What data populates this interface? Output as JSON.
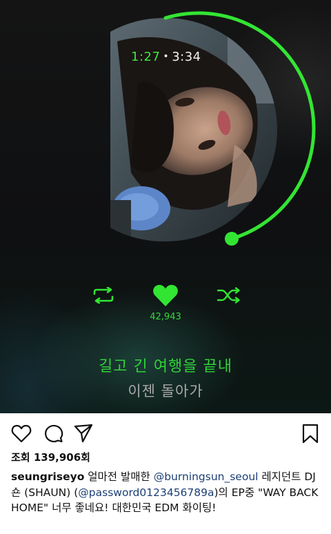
{
  "player": {
    "time_current": "1:27",
    "time_separator": "•",
    "time_total": "3:34",
    "progress_fraction": 0.406,
    "accent_color": "#33e533",
    "likes_count": "42,943"
  },
  "lyrics": {
    "current": "길고 긴 여행을 끝내",
    "next": "이젠 돌아가"
  },
  "post": {
    "views_label": "조회",
    "views_count": "139,906회",
    "username": "seungriseyo",
    "caption_part1": " 얼마전 발매한 ",
    "mention1": "@burningsun_seoul",
    "caption_part2": " 레지던트 DJ 숀 (SHAUN) (",
    "mention2": "@password0123456789a",
    "caption_part3": ")의 EP중 \"WAY BACK HOME\" 너무 좋네요! 대한민국 EDM 화이팅!"
  },
  "icons": {
    "repeat": "repeat-icon",
    "heart": "heart-icon",
    "shuffle": "shuffle-icon",
    "like": "heart-outline-icon",
    "comment": "comment-icon",
    "share": "share-icon",
    "save": "bookmark-icon"
  }
}
